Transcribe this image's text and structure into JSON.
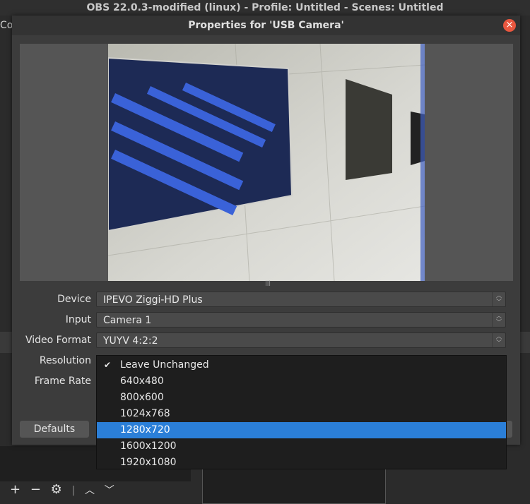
{
  "main_window": {
    "title": "OBS 22.0.3-modified (linux) - Profile: Untitled - Scenes: Untitled",
    "left_text": "Co"
  },
  "dialog": {
    "title": "Properties for 'USB Camera'",
    "close_glyph": "×",
    "device_label": "Device",
    "device_value": "IPEVO Ziggi-HD Plus",
    "input_label": "Input",
    "input_value": "Camera 1",
    "video_format_label": "Video Format",
    "video_format_value": "YUYV 4:2:2",
    "resolution_label": "Resolution",
    "frame_rate_label": "Frame Rate",
    "defaults_label": "Defaults"
  },
  "resolution_dropdown": {
    "options": [
      {
        "label": "Leave Unchanged",
        "checked": true
      },
      {
        "label": "640x480"
      },
      {
        "label": "800x600"
      },
      {
        "label": "1024x768"
      },
      {
        "label": "1280x720",
        "highlighted": true
      },
      {
        "label": "1600x1200"
      },
      {
        "label": "1920x1080"
      }
    ]
  },
  "toolbar": {
    "add_glyph": "+",
    "remove_glyph": "−",
    "settings_glyph": "⚙",
    "up_glyph": "︿",
    "down_glyph": "﹀"
  },
  "colors": {
    "accent": "#2b7fd8",
    "close_button": "#e9573f"
  }
}
